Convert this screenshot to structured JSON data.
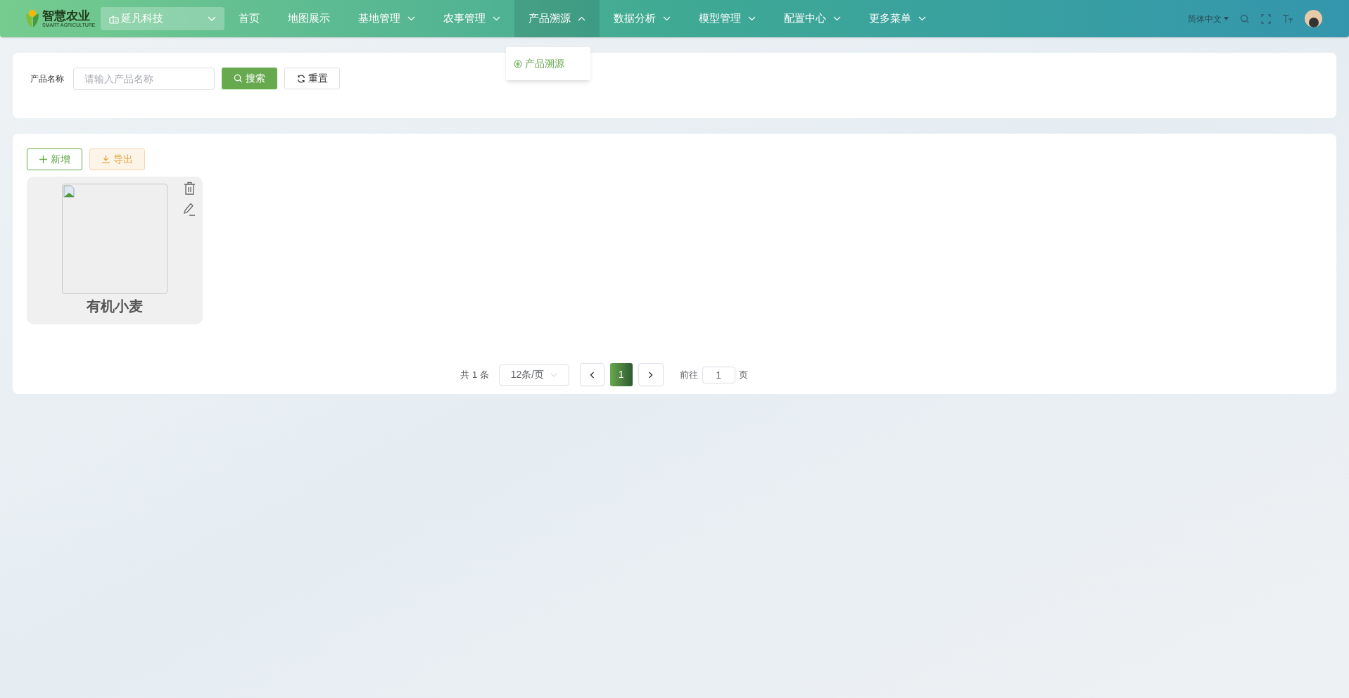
{
  "header": {
    "logo": {
      "title": "智慧农业",
      "subtitle": "SMART AGRICULTURE"
    },
    "org_select": {
      "value": "延凡科技"
    },
    "nav": [
      {
        "label": "首页",
        "selected": false
      },
      {
        "label": "地图展示",
        "selected": false
      },
      {
        "label": "基地管理",
        "dropdown": true,
        "selected": false
      },
      {
        "label": "农事管理",
        "dropdown": true,
        "selected": false
      },
      {
        "label": "产品溯源",
        "dropdown": true,
        "selected": true
      },
      {
        "label": "数据分析",
        "dropdown": true,
        "selected": false
      },
      {
        "label": "模型管理",
        "dropdown": true,
        "selected": false
      },
      {
        "label": "配置中心",
        "dropdown": true,
        "selected": false
      },
      {
        "label": "更多菜单",
        "dropdown": true,
        "selected": false
      }
    ],
    "language": "简体中文"
  },
  "submenu": [
    {
      "label": "产品溯源"
    }
  ],
  "search": {
    "label": "产品名称",
    "placeholder": "请输入产品名称",
    "search_button": "搜索",
    "reset_button": "重置"
  },
  "toolbar": {
    "add_button": "新增",
    "export_button": "导出"
  },
  "products": [
    {
      "name": "有机小麦"
    }
  ],
  "pagination": {
    "total": "共 1 条",
    "page_size": "12条/页",
    "pages": [
      {
        "label": "1",
        "selected": true
      }
    ],
    "goto_label": "前往",
    "goto_value": "1",
    "goto_suffix": "页"
  }
}
